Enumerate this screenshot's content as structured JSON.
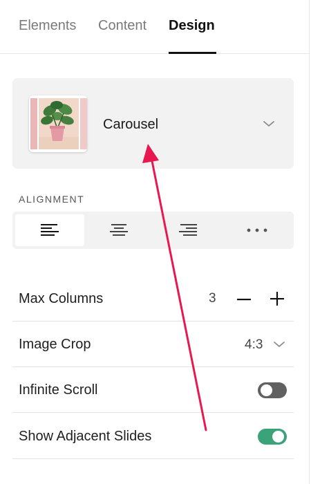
{
  "tabs": [
    {
      "label": "Elements",
      "active": false
    },
    {
      "label": "Content",
      "active": false
    },
    {
      "label": "Design",
      "active": true
    }
  ],
  "layout": {
    "name": "Carousel",
    "thumbnail_icon": "plant-image-icon",
    "chevron_icon": "chevron-down-icon"
  },
  "alignment": {
    "label": "ALIGNMENT",
    "options": [
      {
        "icon": "align-left-icon",
        "selected": true
      },
      {
        "icon": "align-center-icon",
        "selected": false
      },
      {
        "icon": "align-right-icon",
        "selected": false
      },
      {
        "icon": "more-icon",
        "selected": false
      }
    ]
  },
  "settings": {
    "max_columns": {
      "label": "Max Columns",
      "value": "3"
    },
    "image_crop": {
      "label": "Image Crop",
      "value": "4:3"
    },
    "infinite_scroll": {
      "label": "Infinite Scroll",
      "enabled": false
    },
    "show_adjacent_slides": {
      "label": "Show Adjacent Slides",
      "enabled": true
    }
  },
  "colors": {
    "accent_toggle_on": "#3aa37a",
    "toggle_off": "#616161",
    "annotation_arrow": "#e8174f"
  }
}
